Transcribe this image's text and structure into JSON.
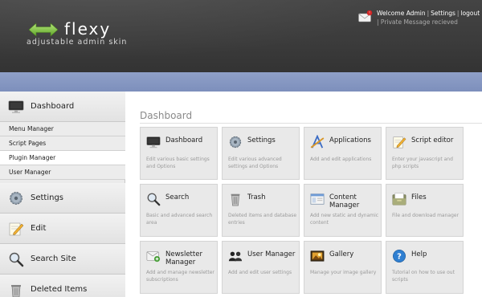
{
  "brand": {
    "name": "flexy",
    "tagline": "adjustable admin skin"
  },
  "topnav": {
    "welcome": "Welcome Admin",
    "settings": "Settings",
    "logout": "logout",
    "message": "Private Message recieved"
  },
  "sidebar": {
    "dashboard": "Dashboard",
    "subitems": [
      "Menu Manager",
      "Script Pages",
      "Plugin Manager",
      "User Manager"
    ],
    "settings": "Settings",
    "edit": "Edit",
    "search": "Search Site",
    "deleted": "Deleted Items"
  },
  "main": {
    "title": "Dashboard",
    "tiles": [
      {
        "title": "Dashboard",
        "desc": "Edit various basic settings and Options",
        "icon": "monitor-icon"
      },
      {
        "title": "Settings",
        "desc": "Edit various advanced settings and Options",
        "icon": "gear-icon"
      },
      {
        "title": "Applications",
        "desc": "Add and edit applications",
        "icon": "applications-icon"
      },
      {
        "title": "Script editor",
        "desc": "Enter your javascript and php scripts",
        "icon": "pencil-icon"
      },
      {
        "title": "Search",
        "desc": "Basic and advanced search area",
        "icon": "search-icon"
      },
      {
        "title": "Trash",
        "desc": "Deleted items and database entries",
        "icon": "trash-icon"
      },
      {
        "title": "Content Manager",
        "desc": "Add new static and dynamic content",
        "icon": "content-icon"
      },
      {
        "title": "Files",
        "desc": "File and download manager",
        "icon": "files-icon"
      },
      {
        "title": "Newsletter Manager",
        "desc": "Add and manage newsletter subscriptions",
        "icon": "newsletter-icon"
      },
      {
        "title": "User Manager",
        "desc": "Add and edit user settings",
        "icon": "users-icon"
      },
      {
        "title": "Gallery",
        "desc": "Manage your image gallery",
        "icon": "gallery-icon"
      },
      {
        "title": "Help",
        "desc": "Tutorial on how to use out scripts",
        "icon": "help-icon"
      }
    ]
  },
  "colors": {
    "header": "#3d3d3d",
    "bluebar": "#8495c2",
    "accent": "#7cc142"
  }
}
